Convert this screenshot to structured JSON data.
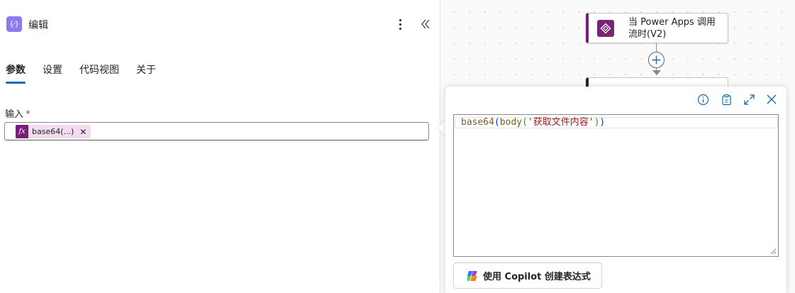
{
  "panel": {
    "app_icon_glyph": "{⁄}",
    "title": "编辑",
    "tabs": [
      {
        "label": "参数",
        "active": true
      },
      {
        "label": "设置",
        "active": false
      },
      {
        "label": "代码视图",
        "active": false
      },
      {
        "label": "关于",
        "active": false
      }
    ],
    "input": {
      "label": "输入",
      "required_mark": "*",
      "token_glyph": "fx",
      "token_text": "base64(...)",
      "token_remove": "✕"
    }
  },
  "canvas": {
    "trigger_node": {
      "line1": "当 Power Apps 调用",
      "line2": "流时(V2)"
    }
  },
  "expression_editor": {
    "expression": "base64(body('获取文件内容'))",
    "copilot_button": "使用 Copilot 创建表达式"
  },
  "colors": {
    "accent": "#0f6cbd",
    "token_bg": "#f3dbf0",
    "token_icon": "#7a1d77",
    "app_icon": "#8a7cf0",
    "power_apps": "#742774"
  },
  "icons": {
    "more": "more-vertical-icon",
    "collapse": "double-chevron-left-icon",
    "info": "info-icon",
    "copy": "clipboard-icon",
    "expand": "expand-icon",
    "close": "close-icon",
    "add": "plus-icon",
    "copilot": "copilot-icon"
  }
}
